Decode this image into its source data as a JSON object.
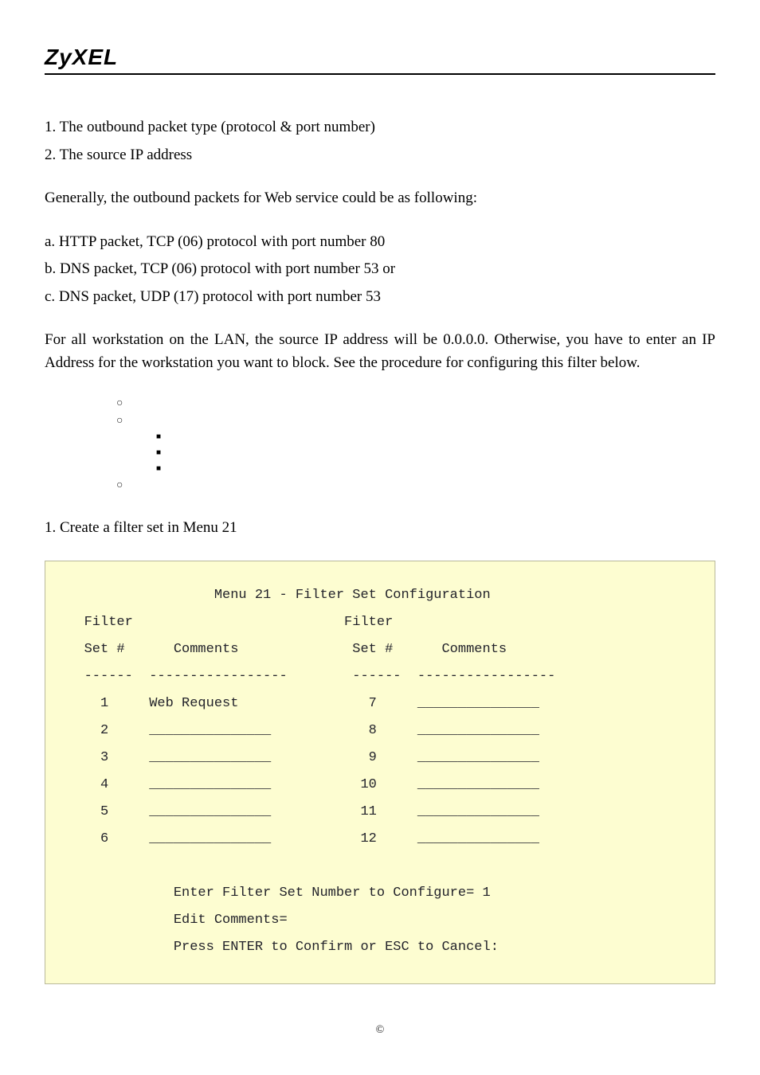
{
  "brand": "ZyXEL",
  "intro": {
    "item1": "1. The outbound packet type (protocol & port number)",
    "item2": "2. The source IP address",
    "generally": "Generally, the outbound packets for Web service could be as following:",
    "a": "a. HTTP packet, TCP (06) protocol with port number 80",
    "b": "b. DNS packet, TCP (06) protocol with port number 53 or",
    "c": "c. DNS packet, UDP (17) protocol with port number 53",
    "for_all": "For all workstation on the LAN, the source IP address will be 0.0.0.0. Otherwise, you have to enter an IP Address for the workstation you want to block. See the procedure for configuring this filter below."
  },
  "step1": "1. Create a filter set in Menu 21",
  "menu": {
    "title": "                   Menu 21 - Filter Set Configuration",
    "hdr1": "   Filter                          Filter",
    "hdr2": "   Set #      Comments              Set #      Comments",
    "sep": "   ------  -----------------        ------  -----------------",
    "r1": "     1     Web Request                7     _______________",
    "r2": "     2     _______________            8     _______________",
    "r3": "     3     _______________            9     _______________",
    "r4": "     4     _______________           10     _______________",
    "r5": "     5     _______________           11     _______________",
    "r6": "     6     _______________           12     _______________",
    "p1": "              Enter Filter Set Number to Configure= 1",
    "p2": "              Edit Comments=",
    "p3": "              Press ENTER to Confirm or ESC to Cancel:"
  },
  "footer": "©"
}
